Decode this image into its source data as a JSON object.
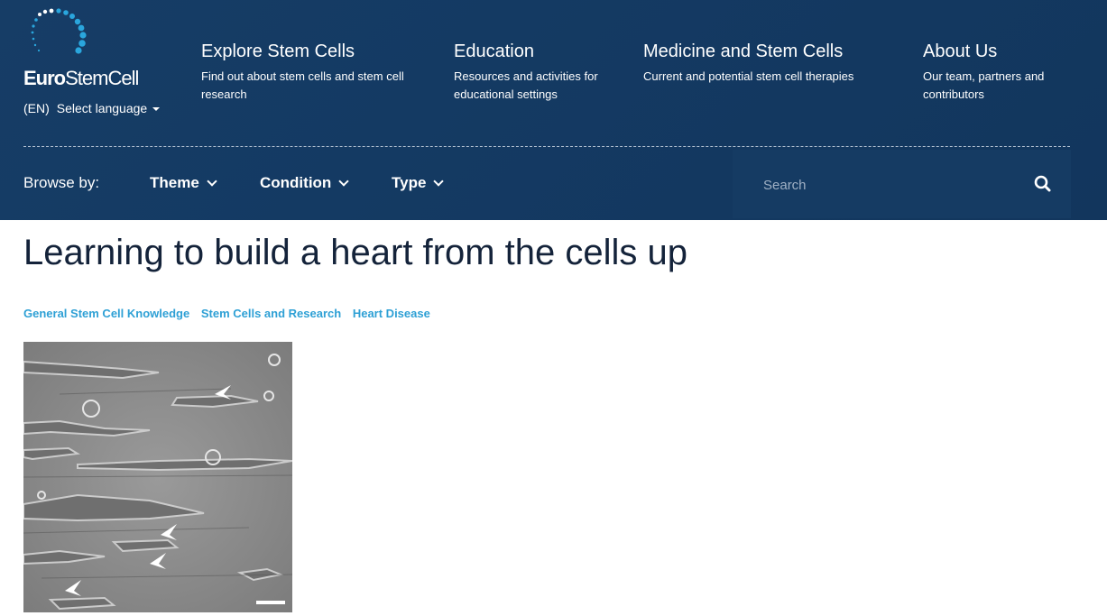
{
  "header": {
    "logo": {
      "text_bold": "Euro",
      "text_rest": "StemCell"
    },
    "language": {
      "code": "(EN)",
      "label": "Select language"
    },
    "nav": [
      {
        "title": "Explore Stem Cells",
        "desc": "Find out about stem cells and stem cell research"
      },
      {
        "title": "Education",
        "desc": "Resources and activities for educational settings"
      },
      {
        "title": "Medicine and Stem Cells",
        "desc": "Current and potential stem cell therapies"
      },
      {
        "title": "About Us",
        "desc": "Our team, partners and contributors"
      }
    ],
    "browse": {
      "label": "Browse by:",
      "items": [
        "Theme",
        "Condition",
        "Type"
      ]
    },
    "search": {
      "placeholder": "Search",
      "icon": "search-icon"
    }
  },
  "article": {
    "title": "Learning to build a heart from the cells up",
    "tags": [
      "General Stem Cell Knowledge",
      "Stem Cells and Research",
      "Heart Disease"
    ],
    "image_icon": "cell-microscopy-image"
  },
  "colors": {
    "header_bg": "#163d66",
    "tag_link": "#2ea0d5",
    "title": "#14233a"
  }
}
